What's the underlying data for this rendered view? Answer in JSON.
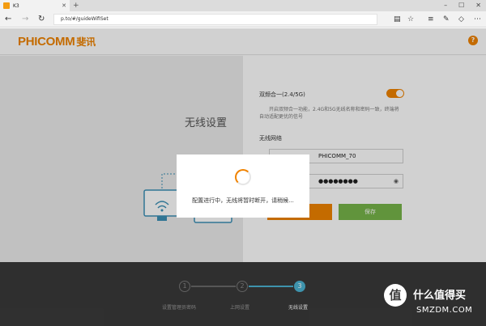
{
  "browser": {
    "tab_title": "K3",
    "new_tab": "+",
    "url": "p.to/#/guideWifiSet",
    "win_minimize": "–",
    "win_maximize": "☐",
    "win_close": "✕",
    "icons": [
      "back-icon",
      "forward-icon",
      "refresh-icon",
      "reading-view-icon",
      "favorite-star-icon",
      "hub-icon",
      "web-note-icon",
      "share-icon",
      "more-icon"
    ]
  },
  "header": {
    "logo": "PHICOMM",
    "logo_cn": "斐讯",
    "help": "?"
  },
  "left": {
    "section_title": "无线设置"
  },
  "form": {
    "dual_band_label": "双频合一(2.4/5G)",
    "dual_band_on": true,
    "description": "开启双频合一功能，2.4G和5G无线名称和密码一致，终端将自动适配更优的信号",
    "network_label": "无线网络",
    "ssid_value": "PHICOMM_70",
    "password_value": "●●●●●●●●",
    "eye_icon": "eye-icon",
    "save_label": "保存",
    "accent_color": "#f08300",
    "save_color": "#77b54a"
  },
  "steps": [
    {
      "num": "1",
      "label": "设置管理员密码",
      "active": false
    },
    {
      "num": "2",
      "label": "上网设置",
      "active": false
    },
    {
      "num": "3",
      "label": "无线设置",
      "active": true
    }
  ],
  "modal": {
    "message": "配置进行中，无线将暂时断开，请稍候..."
  },
  "watermark": {
    "badge": "值",
    "title": "什么值得买",
    "subtitle": "SMZDM.COM"
  }
}
